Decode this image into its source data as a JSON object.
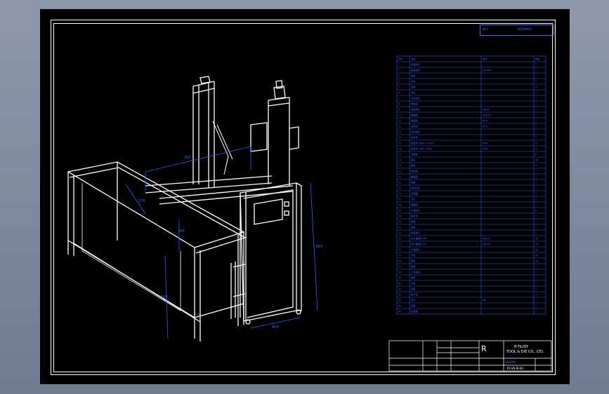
{
  "drawing_number": "HS5MM02",
  "code_box_label": "图号",
  "dimensions": {
    "top_width": "350",
    "top_depth": "270",
    "column_height": "600",
    "base_depth": "300",
    "left_height": "500",
    "base_width": "400"
  },
  "bom": {
    "headers": [
      "序号",
      "名称",
      "型号",
      "数量"
    ],
    "rows": [
      {
        "no": "1",
        "name": "机架组件",
        "spec": "",
        "qty": "1"
      },
      {
        "no": "2",
        "name": "直线模组",
        "spec": "HS5MM",
        "qty": "1"
      },
      {
        "no": "3",
        "name": "底板",
        "spec": "",
        "qty": "1"
      },
      {
        "no": "4",
        "name": "立柱",
        "spec": "",
        "qty": "2"
      },
      {
        "no": "5",
        "name": "滑块",
        "spec": "",
        "qty": "4"
      },
      {
        "no": "6",
        "name": "导轨",
        "spec": "",
        "qty": "2"
      },
      {
        "no": "7",
        "name": "丝杆组件",
        "spec": "",
        "qty": "1"
      },
      {
        "no": "8",
        "name": "电机座",
        "spec": "",
        "qty": "1"
      },
      {
        "no": "9",
        "name": "伺服电机",
        "spec": "400W",
        "qty": "1"
      },
      {
        "no": "10",
        "name": "联轴器",
        "spec": "D25L30",
        "qty": "1"
      },
      {
        "no": "11",
        "name": "轴承座",
        "spec": "BK12",
        "qty": "1"
      },
      {
        "no": "12",
        "name": "支撑座",
        "spec": "BF12",
        "qty": "1"
      },
      {
        "no": "13",
        "name": "同步带轮",
        "spec": "",
        "qty": "2"
      },
      {
        "no": "14",
        "name": "同步带",
        "spec": "",
        "qty": "1"
      },
      {
        "no": "15",
        "name": "铝型材 4040 L=1000",
        "spec": "4040",
        "qty": "4"
      },
      {
        "no": "16",
        "name": "铝型材 4040 L=800",
        "spec": "4040",
        "qty": "4"
      },
      {
        "no": "17",
        "name": "连接板",
        "spec": "",
        "qty": "8"
      },
      {
        "no": "18",
        "name": "角码",
        "spec": "",
        "qty": "16"
      },
      {
        "no": "19",
        "name": "脚杯",
        "spec": "",
        "qty": "4"
      },
      {
        "no": "20",
        "name": "电控箱",
        "spec": "",
        "qty": "1"
      },
      {
        "no": "21",
        "name": "触摸屏",
        "spec": "",
        "qty": "1"
      },
      {
        "no": "22",
        "name": "按钮",
        "spec": "",
        "qty": "3"
      },
      {
        "no": "23",
        "name": "急停开关",
        "spec": "",
        "qty": "1"
      },
      {
        "no": "24",
        "name": "传感器",
        "spec": "",
        "qty": "3"
      },
      {
        "no": "25",
        "name": "气缸",
        "spec": "",
        "qty": "2"
      },
      {
        "no": "26",
        "name": "电磁阀",
        "spec": "",
        "qty": "2"
      },
      {
        "no": "27",
        "name": "气管接头",
        "spec": "",
        "qty": "6"
      },
      {
        "no": "28",
        "name": "防护罩",
        "spec": "",
        "qty": "1"
      },
      {
        "no": "29",
        "name": "拖链",
        "spec": "",
        "qty": "1"
      },
      {
        "no": "30",
        "name": "线槽",
        "spec": "",
        "qty": "2"
      },
      {
        "no": "31",
        "name": "接线端子",
        "spec": "",
        "qty": "1"
      },
      {
        "no": "32",
        "name": "内六角螺钉 M6",
        "spec": "M6x20",
        "qty": "40"
      },
      {
        "no": "33",
        "name": "内六角螺钉 M5",
        "spec": "M5x16",
        "qty": "30"
      },
      {
        "no": "34",
        "name": "T型螺母",
        "spec": "",
        "qty": "40"
      },
      {
        "no": "35",
        "name": "平垫",
        "spec": "",
        "qty": "40"
      },
      {
        "no": "36",
        "name": "弹垫",
        "spec": "",
        "qty": "40"
      },
      {
        "no": "37",
        "name": "铭牌",
        "spec": "",
        "qty": "1"
      },
      {
        "no": "38",
        "name": "工作台面",
        "spec": "",
        "qty": "1"
      },
      {
        "no": "39",
        "name": "侧板",
        "spec": "",
        "qty": "2"
      },
      {
        "no": "40",
        "name": "后板",
        "spec": "",
        "qty": "1"
      },
      {
        "no": "41",
        "name": "底座",
        "spec": "",
        "qty": "1"
      },
      {
        "no": "42",
        "name": "调平垫",
        "spec": "",
        "qty": "4"
      },
      {
        "no": "43",
        "name": "吊环",
        "spec": "M8",
        "qty": "2"
      },
      {
        "no": "44",
        "name": "标签",
        "spec": "",
        "qty": "1"
      },
      {
        "no": "45",
        "name": "包装箱",
        "spec": "",
        "qty": "1"
      }
    ]
  },
  "title_block": {
    "company_line1": "R-TILIDY",
    "company_line2": "TOOL & DIE CO., LTD.",
    "logo_letter": "R",
    "drawing_name": "HS5MM",
    "drawing_code": "P1-VS-M-00"
  }
}
